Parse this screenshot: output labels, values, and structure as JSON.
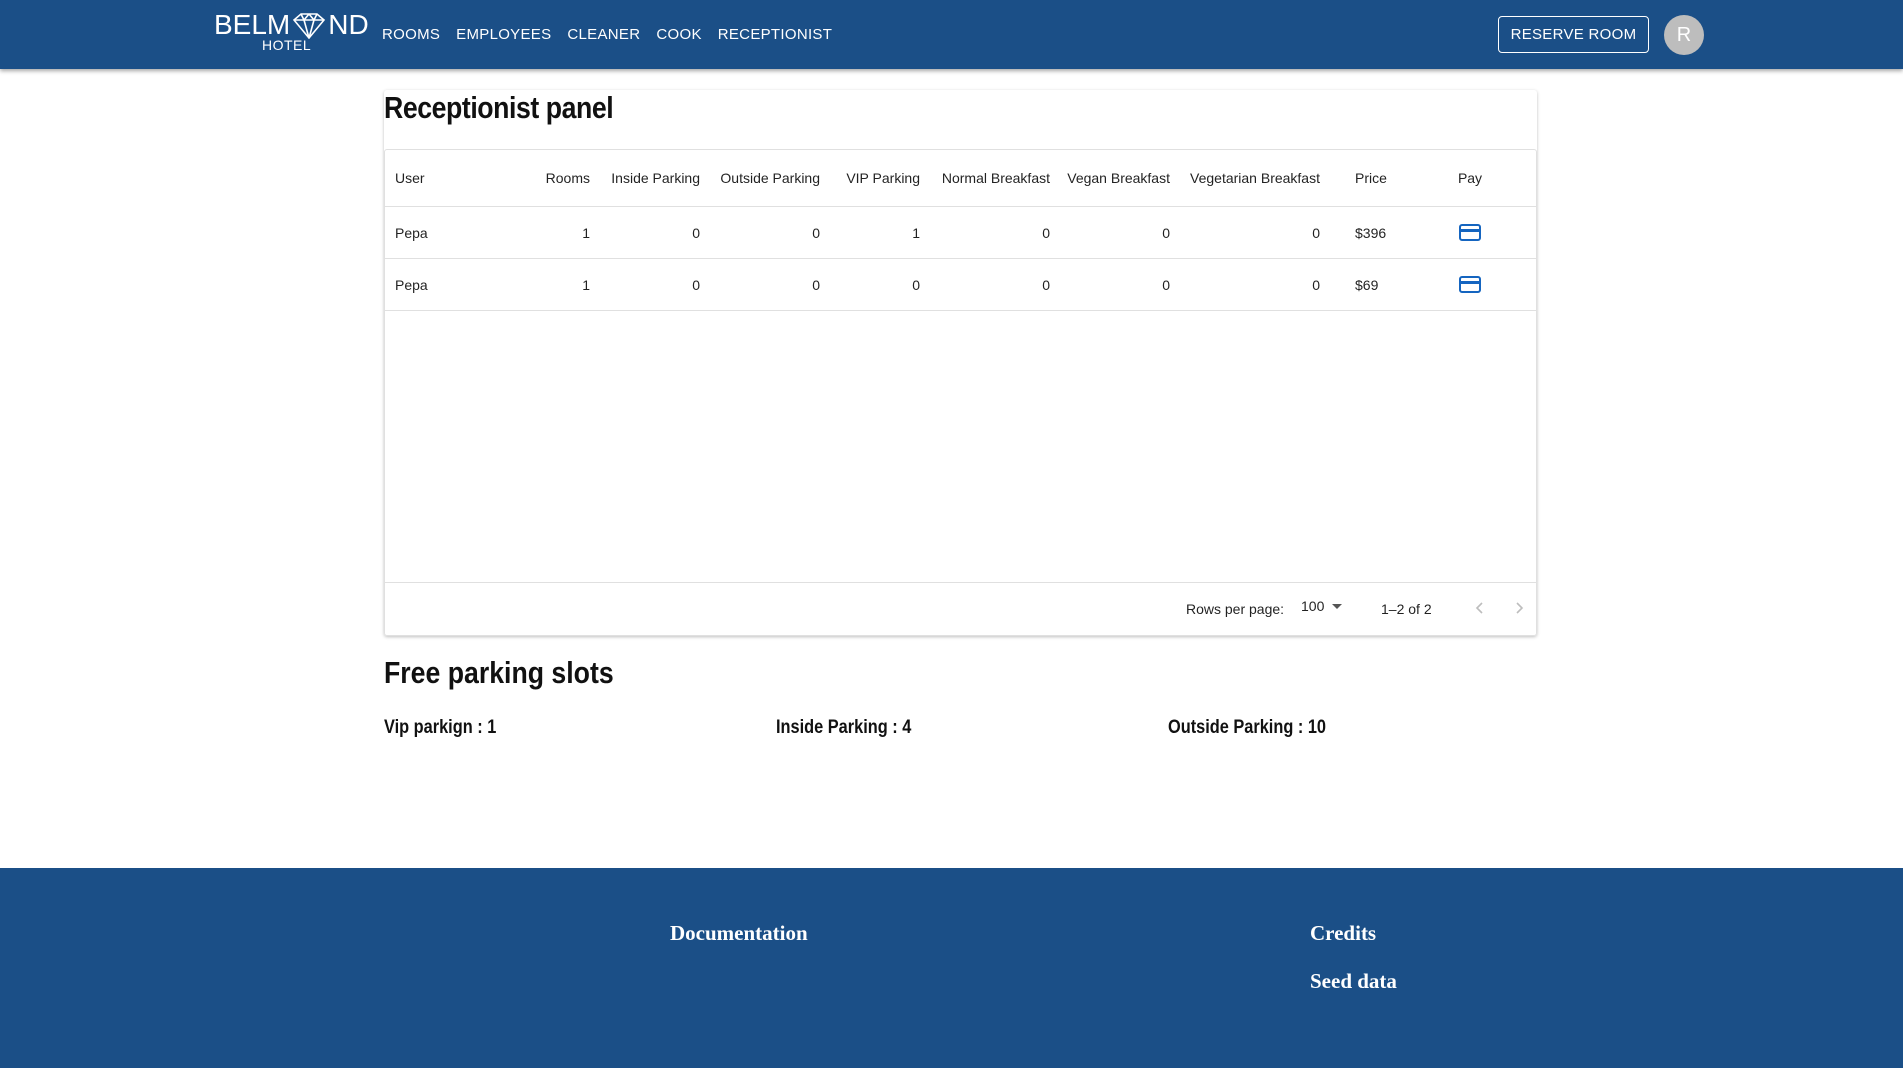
{
  "header": {
    "logo_main_left": "BELM",
    "logo_main_right": "ND",
    "logo_sub": "HOTEL",
    "nav": [
      "ROOMS",
      "EMPLOYEES",
      "CLEANER",
      "COOK",
      "RECEPTIONIST"
    ],
    "reserve_label": "RESERVE ROOM",
    "avatar_initial": "R"
  },
  "panel": {
    "title": "Receptionist panel",
    "columns": [
      "User",
      "Rooms",
      "Inside Parking",
      "Outside Parking",
      "VIP Parking",
      "Normal Breakfast",
      "Vegan Breakfast",
      "Vegetarian Breakfast",
      "Price",
      "Pay"
    ],
    "rows": [
      [
        "Pepa",
        "1",
        "0",
        "0",
        "1",
        "0",
        "0",
        "0",
        "$396"
      ],
      [
        "Pepa",
        "1",
        "0",
        "0",
        "0",
        "0",
        "0",
        "0",
        "$69"
      ]
    ],
    "pagination": {
      "rows_per_page_label": "Rows per page:",
      "rows_per_page_value": "100",
      "range": "1–2 of 2"
    }
  },
  "parking": {
    "title": "Free parking slots",
    "vip": "Vip parkign : 1",
    "inside": "Inside Parking : 4",
    "outside": "Outside Parking : 10"
  },
  "footer": {
    "documentation": "Documentation",
    "credits": "Credits",
    "seed_data": "Seed data"
  },
  "colors": {
    "brand": "#1b4f87",
    "pay_icon": "#1565c0"
  }
}
